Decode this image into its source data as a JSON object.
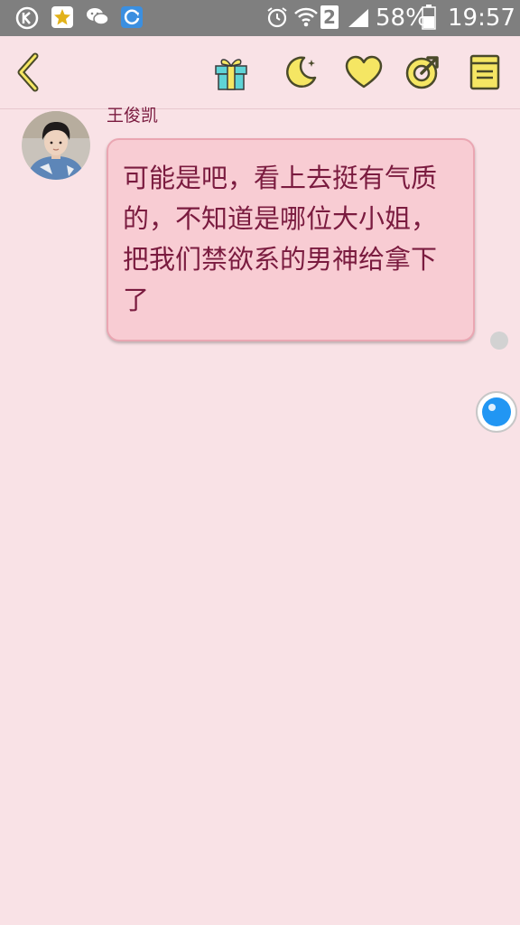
{
  "status_bar": {
    "battery_percent": "58%",
    "time": "19:57",
    "sim_slot": "2",
    "icons": [
      "k-app-icon",
      "star-app-icon",
      "wechat-icon",
      "sync-app-icon",
      "alarm-icon",
      "wifi-icon",
      "sim-2-icon",
      "signal-icon",
      "battery-icon"
    ]
  },
  "toolbar": {
    "icons": [
      "back-icon",
      "gift-icon",
      "moon-icon",
      "heart-icon",
      "share-icon",
      "note-icon"
    ],
    "accent_color": "#f5e663",
    "outline_color": "#4a4a2a"
  },
  "chat": {
    "messages": [
      {
        "sender": "王俊凯",
        "text": "可能是吧，看上去挺有气质的，不知道是哪位大小姐，把我们禁欲系的男神给拿下了"
      }
    ]
  },
  "colors": {
    "background": "#f9e2e6",
    "status_bar": "#7f7f7f",
    "bubble": "#f8ccd3",
    "text": "#7a1b3f",
    "float_button": "#2196f3"
  }
}
